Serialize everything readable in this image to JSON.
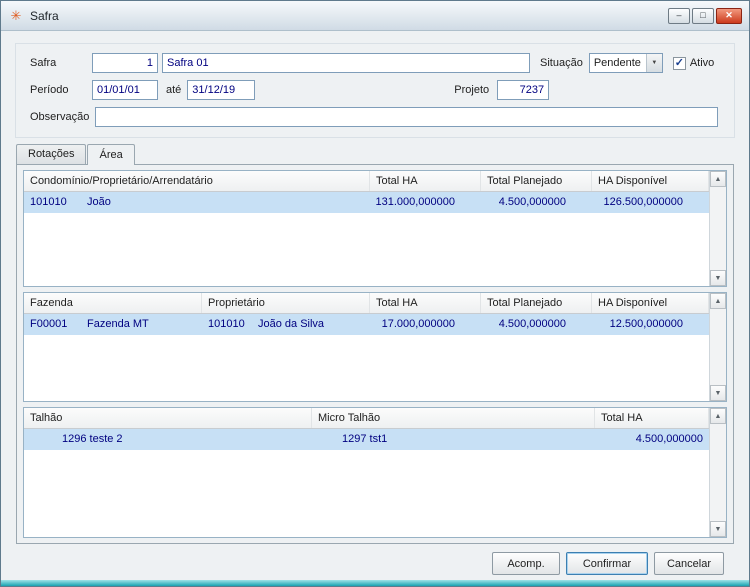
{
  "window": {
    "title": "Safra"
  },
  "icons": {
    "app": "✳",
    "minimize": "–",
    "maximize": "□",
    "close": "✕",
    "dropdown": "▼",
    "check": "✓",
    "scroll_up": "▲",
    "scroll_down": "▼"
  },
  "form": {
    "labels": {
      "safra": "Safra",
      "situacao": "Situação",
      "ativo": "Ativo",
      "periodo": "Período",
      "ate": "até",
      "projeto": "Projeto",
      "observacao": "Observação"
    },
    "values": {
      "safra_code": "1",
      "safra_name": "Safra 01",
      "situacao": "Pendente",
      "periodo_inicio": "01/01/01",
      "periodo_fim": "31/12/19",
      "projeto": "7237",
      "observacao": ""
    }
  },
  "tabs": [
    {
      "label": "Rotações"
    },
    {
      "label": "Área"
    }
  ],
  "grid_condominio": {
    "columns": [
      "Condomínio/Proprietário/Arrendatário",
      "Total HA",
      "Total Planejado",
      "HA Disponível"
    ],
    "row": {
      "codigo": "101010",
      "nome": "João",
      "total_ha": "131.000,000000",
      "total_planejado": "4.500,000000",
      "ha_disponivel": "126.500,000000"
    }
  },
  "grid_fazenda": {
    "columns": [
      "Fazenda",
      "Proprietário",
      "Total HA",
      "Total Planejado",
      "HA Disponível"
    ],
    "row": {
      "fazenda_codigo": "F00001",
      "fazenda_nome": "Fazenda MT",
      "proprietario_codigo": "101010",
      "proprietario_nome": "João da Silva",
      "total_ha": "17.000,000000",
      "total_planejado": "4.500,000000",
      "ha_disponivel": "12.500,000000"
    }
  },
  "grid_talhao": {
    "columns": [
      "Talhão",
      "Micro Talhão",
      "Total HA"
    ],
    "row": {
      "talhao": "1296 teste 2",
      "micro_talhao": "1297 tst1",
      "total_ha": "4.500,000000"
    }
  },
  "buttons": {
    "acomp": "Acomp.",
    "confirmar": "Confirmar",
    "cancelar": "Cancelar"
  }
}
